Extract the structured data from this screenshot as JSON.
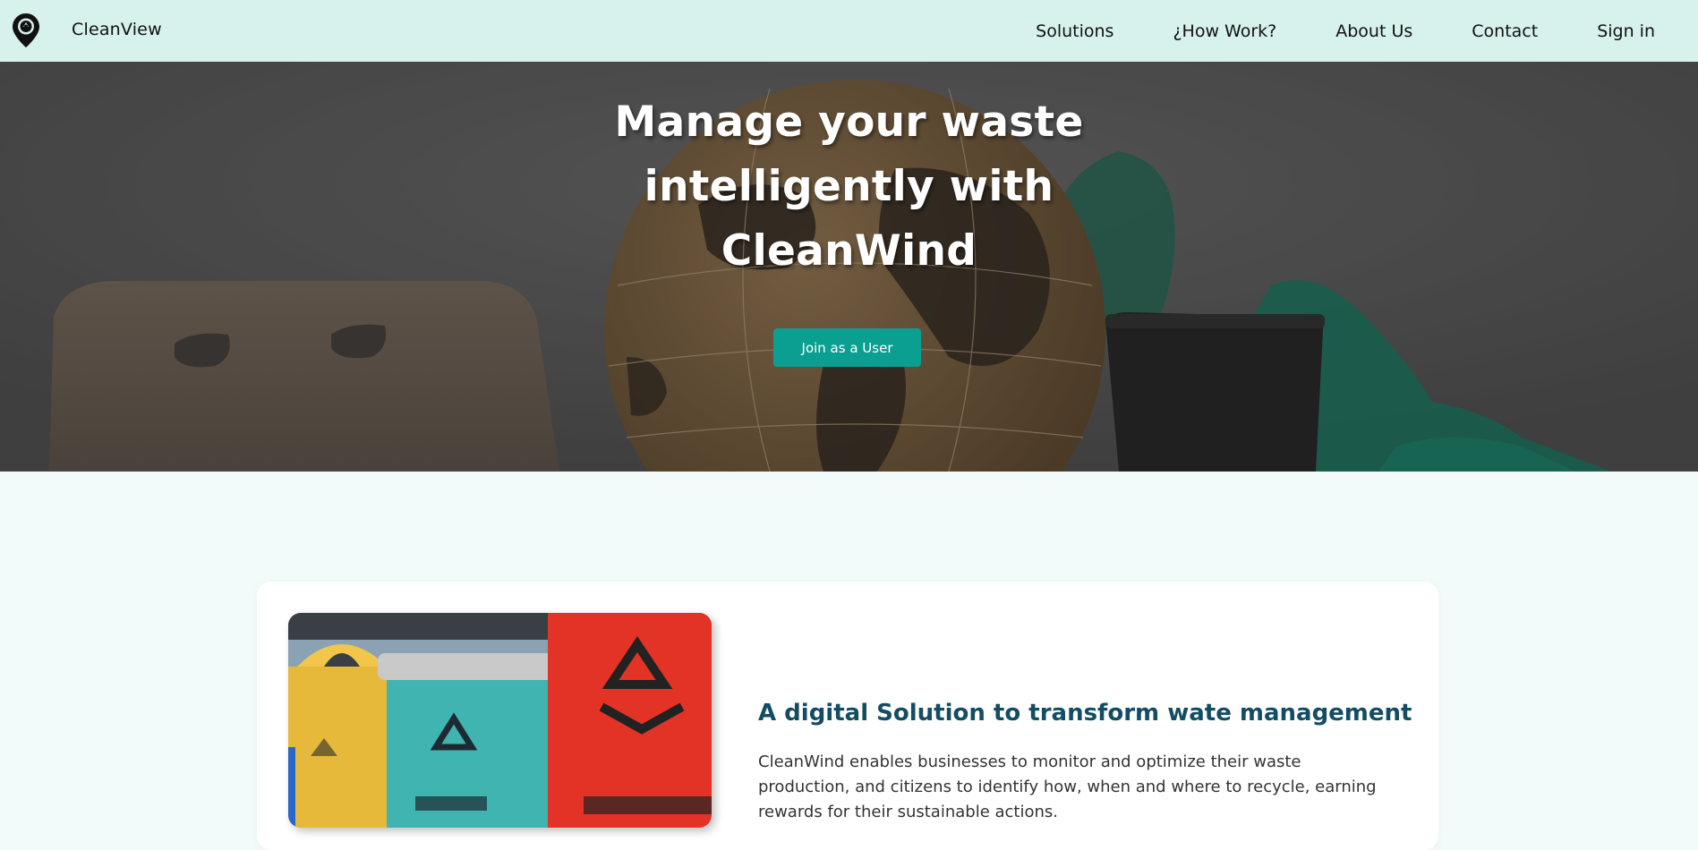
{
  "brand": {
    "name": "CleanView",
    "logo_icon": "map-pin-recycle-icon"
  },
  "nav": {
    "items": [
      {
        "label": "Solutions"
      },
      {
        "label": "¿How Work?"
      },
      {
        "label": "About Us"
      },
      {
        "label": "Contact"
      },
      {
        "label": "Sign in"
      }
    ]
  },
  "hero": {
    "title_lines": [
      "Manage your waste",
      "intelligently with",
      "CleanWind"
    ],
    "cta_label": "Join as a User"
  },
  "feature": {
    "title": "A digital Solution to transform wate management",
    "text": "CleanWind enables businesses to monitor and optimize their waste production, and citizens to identify how, when and where to recycle, earning rewards for their sustainable actions."
  },
  "colors": {
    "nav_bg": "#d7f1ec",
    "accent": "#0b9f91",
    "heading": "#144d63"
  }
}
